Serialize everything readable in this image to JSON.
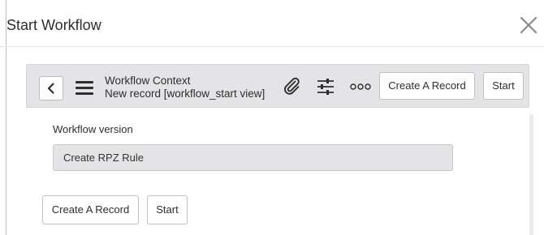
{
  "modal": {
    "title": "Start Workflow",
    "close_icon": "close-icon"
  },
  "toolbar": {
    "back_icon": "chevron-left-icon",
    "menu_icon": "hamburger-menu-icon",
    "context_title": "Workflow Context",
    "context_subtitle": "New record [workflow_start view]",
    "attachment_icon": "paperclip-icon",
    "personalize_icon": "sliders-icon",
    "more_icon": "more-options-icon",
    "create_record_label": "Create A Record",
    "start_label": "Start"
  },
  "form": {
    "workflow_version_label": "Workflow version",
    "workflow_version_value": "Create RPZ Rule"
  },
  "footer": {
    "create_record_label": "Create A Record",
    "start_label": "Start"
  }
}
